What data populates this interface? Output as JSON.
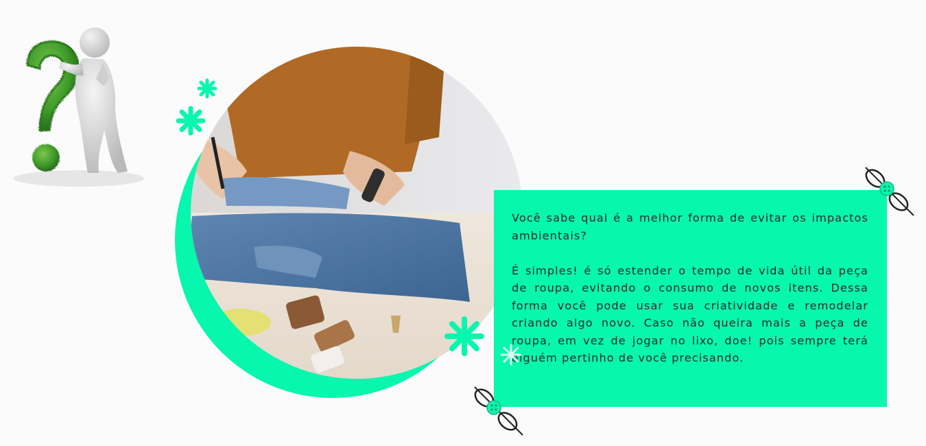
{
  "colors": {
    "accent": "#06f7ad",
    "text": "#2b2b2b",
    "background": "#fbfbfc"
  },
  "illustrations": {
    "question_figure": "3d-person-leaning-on-green-grass-question-mark",
    "photo": "person-cutting-denim-jeans-with-scissors-sewing-spools-thimble",
    "decorations": [
      "sparkle-icon",
      "button-and-needle-icon"
    ]
  },
  "card": {
    "paragraph1": "Você sabe qual é a melhor forma de evitar os impactos ambientais?",
    "paragraph2": "É simples! é só estender o tempo de vida útil da peça de roupa, evitando o consumo de novos itens. Dessa forma você pode usar sua criatividade e remodelar criando algo novo. Caso não queira mais a peça de roupa, em vez de jogar no lixo, doe! pois sempre terá alguém pertinho de você precisando."
  }
}
